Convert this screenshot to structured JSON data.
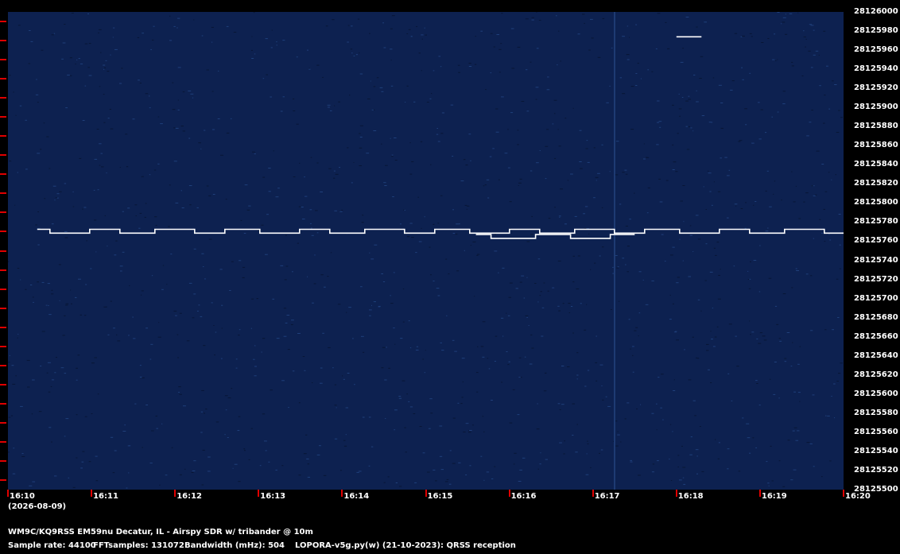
{
  "chart_data": {
    "type": "heatmap",
    "title": "WM9C/KQ9RSS EM59nu Decatur, IL - Airspy SDR w/ tribander @ 10m",
    "x_ticks": [
      "16:10",
      "16:11",
      "16:12",
      "16:13",
      "16:14",
      "16:15",
      "16:16",
      "16:17",
      "16:18",
      "16:19",
      "16:20"
    ],
    "date_label": "(2026-08-09)",
    "y_ticks": [
      28126000,
      28125980,
      28125960,
      28125940,
      28125920,
      28125900,
      28125880,
      28125860,
      28125840,
      28125820,
      28125800,
      28125780,
      28125760,
      28125740,
      28125720,
      28125700,
      28125680,
      28125660,
      28125640,
      28125620,
      28125600,
      28125580,
      28125560,
      28125540,
      28125520,
      28125500
    ],
    "ylim": [
      28125500,
      28126000
    ],
    "xlim_minutes": [
      0,
      10
    ],
    "signals": [
      {
        "name": "main-carrier",
        "freq_hz": 28125770.5,
        "start_min": 0.35,
        "end_min": 10.0,
        "keyed_shift_hz": 4
      },
      {
        "name": "second-trace",
        "freq_hz": 28125765,
        "start_min": 5.6,
        "end_min": 7.5,
        "keyed_shift_hz": 4
      },
      {
        "name": "spot-1817",
        "freq_hz": 28125974,
        "start_min": 8.0,
        "end_min": 8.3,
        "keyed_shift_hz": 0
      }
    ],
    "colors": {
      "background": "#0d2150",
      "signal": "#ffffff",
      "tick_mark": "#e00000"
    }
  },
  "footer": {
    "title": "WM9C/KQ9RSS EM59nu Decatur, IL - Airspy SDR w/ tribander @ 10m",
    "sample_rate": "Sample rate: 44100",
    "fft_samples": "FFTsamples: 131072",
    "bandwidth": "Bandwidth (mHz): 504",
    "software": "LOPORA-v5g.py(w) (21-10-2023): QRSS reception"
  }
}
